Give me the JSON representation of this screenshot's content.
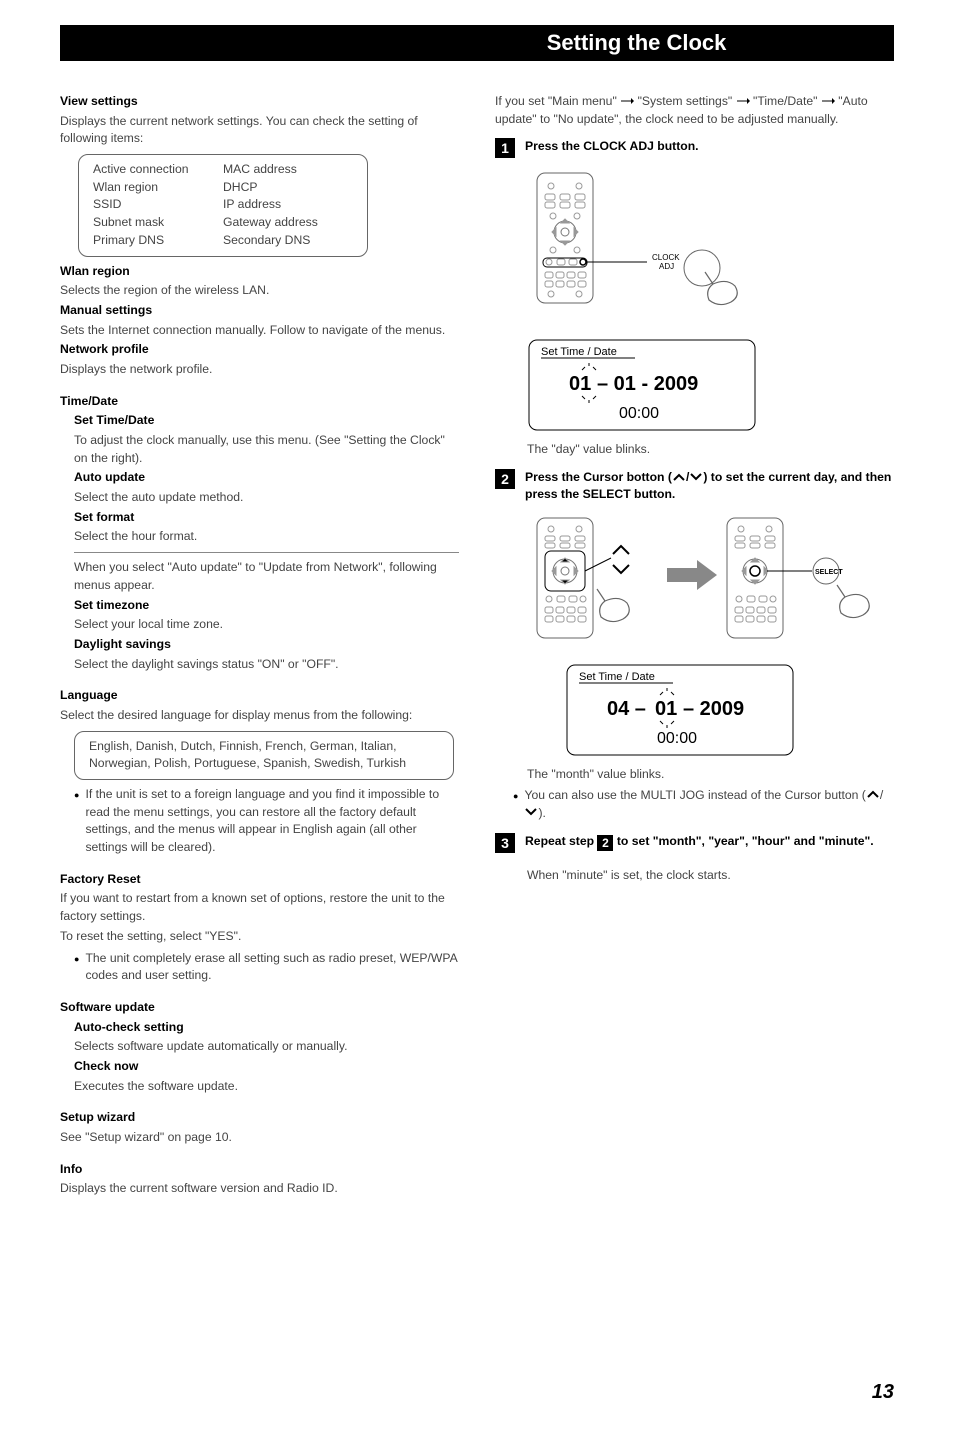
{
  "chapter_title": "Setting the Clock",
  "page_number": "13",
  "left": {
    "view_settings_h": "View settings",
    "view_settings_p": "Displays the current network settings. You can check the setting of following items:",
    "view_settings_items_left": [
      "Active connection",
      "Wlan region",
      "SSID",
      "Subnet mask",
      "Primary DNS"
    ],
    "view_settings_items_right": [
      "MAC address",
      "DHCP",
      "IP address",
      "Gateway address",
      "Secondary DNS"
    ],
    "wlan_region_h": "Wlan region",
    "wlan_region_p": "Selects the region of the wireless LAN.",
    "manual_settings_h": "Manual settings",
    "manual_settings_p": "Sets the Internet connection manually. Follow to navigate of the menus.",
    "network_profile_h": "Network profile",
    "network_profile_p": "Displays the network profile.",
    "time_date_h": "Time/Date",
    "set_time_date_h": "Set Time/Date",
    "set_time_date_p": "To adjust the clock manually, use this menu. (See \"Setting the Clock\" on the right).",
    "auto_update_h": "Auto update",
    "auto_update_p": "Select the auto update method.",
    "set_format_h": "Set format",
    "set_format_p": "Select the hour format.",
    "time_date_note": "When you select \"Auto update\" to \"Update from Network\", following menus appear.",
    "set_timezone_h": "Set timezone",
    "set_timezone_p": "Select your local time zone.",
    "daylight_h": "Daylight savings",
    "daylight_p": "Select the daylight savings status \"ON\" or \"OFF\".",
    "language_h": "Language",
    "language_p": "Select the desired language for display menus from the following:",
    "language_list": "English, Danish, Dutch, Finnish, French, German, Italian, Norwegian, Polish, Portuguese, Spanish, Swedish, Turkish",
    "language_bullet": "If the unit is set to a foreign language and you find it impossible to read the menu settings, you can restore all the factory default settings, and the menus will appear in English again (all other settings will be cleared).",
    "factory_reset_h": "Factory Reset",
    "factory_reset_p1": "If you want to restart from a known set of options, restore the unit to the factory settings.",
    "factory_reset_p2": "To reset the setting, select \"YES\".",
    "factory_reset_bullet": "The unit completely erase all setting such as radio preset, WEP/WPA codes and user setting.",
    "software_update_h": "Software update",
    "auto_check_h": "Auto-check setting",
    "auto_check_p": "Selects software update automatically or manually.",
    "check_now_h": "Check now",
    "check_now_p": "Executes the software update.",
    "setup_wizard_h": "Setup wizard",
    "setup_wizard_p": "See \"Setup wizard\" on page 10.",
    "info_h": "Info",
    "info_p": "Displays the current software version and Radio ID."
  },
  "right": {
    "intro_pre": "If you set \"Main menu\"",
    "intro_mid1": "\"System settings\"",
    "intro_mid2": "\"Time/Date\"",
    "intro_post": "\"Auto update\" to \"No update\", the clock need to be adjusted manually.",
    "step1_num": "1",
    "step1_text": "Press the CLOCK ADJ button.",
    "fig1": {
      "label_clock_adj": "CLOCK\nADJ",
      "lcd_title": "Set Time / Date",
      "lcd_line1_a": "01",
      "lcd_line1_b": "– 01 - 2009",
      "lcd_line2": "00:00"
    },
    "step1_note": "The \"day\" value blinks.",
    "step2_num": "2",
    "step2_text_a": "Press the Cursor botton (",
    "step2_text_b": "/",
    "step2_text_c": ") to set the current day, and then press the SELECT button.",
    "fig2": {
      "label_select": "SELECT",
      "lcd_title": "Set Time / Date",
      "lcd_line1_a": "04 –",
      "lcd_line1_b": "01",
      "lcd_line1_c": "– 2009",
      "lcd_line2": "00:00"
    },
    "step2_note": "The \"month\" value blinks.",
    "step2_bullet_a": "You can also use the MULTI JOG instead of the Cursor button (",
    "step2_bullet_b": "/",
    "step2_bullet_c": ").",
    "step3_num": "3",
    "step3_text_a": "Repeat step",
    "step3_text_b": "to set \"month\", \"year\", \"hour\" and \"minute\".",
    "step3_note": "When \"minute\" is set, the clock starts."
  }
}
